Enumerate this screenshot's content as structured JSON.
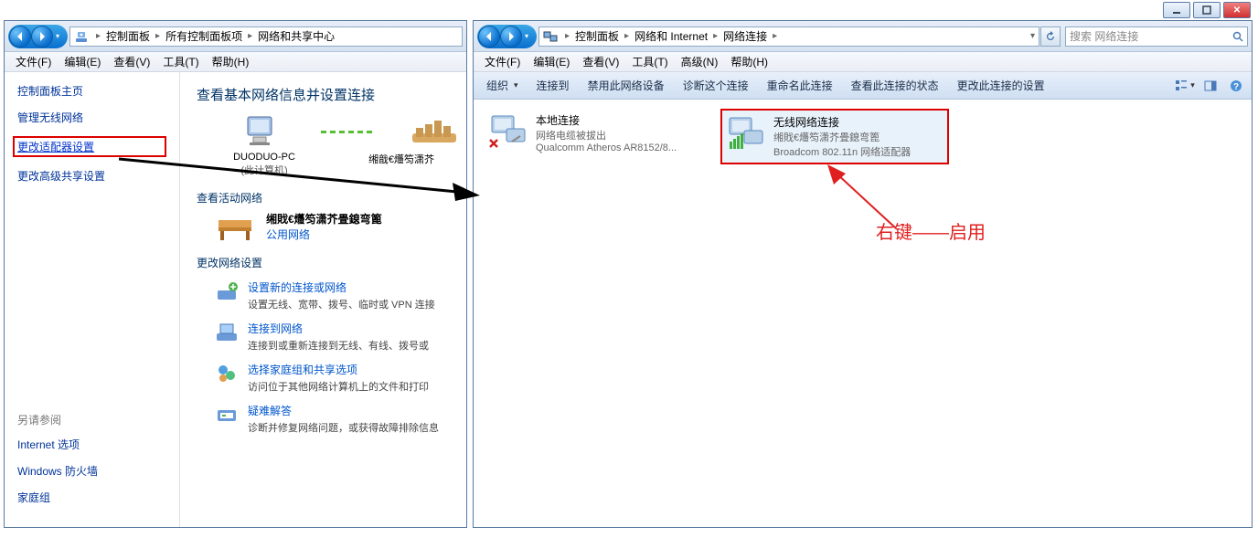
{
  "left_window": {
    "breadcrumb": [
      "控制面板",
      "所有控制面板项",
      "网络和共享中心"
    ],
    "menu": [
      "文件(F)",
      "编辑(E)",
      "查看(V)",
      "工具(T)",
      "帮助(H)"
    ],
    "sidebar": {
      "title": "控制面板主页",
      "links": [
        "管理无线网络",
        "更改适配器设置",
        "更改高级共享设置"
      ],
      "seealso_title": "另请参阅",
      "seealso": [
        "Internet 选项",
        "Windows 防火墙",
        "家庭组"
      ]
    },
    "content": {
      "heading": "查看基本网络信息并设置连接",
      "pc_name": "DUODUO-PC",
      "pc_sub": "(此计算机)",
      "network_name": "缃戠€爡笉潇芥",
      "section_activity": "查看活动网络",
      "active_net_name": "缃戝€爡笉潇芥畳鎴弯篦",
      "active_net_type": "公用网络",
      "section_settings": "更改网络设置",
      "settings": [
        {
          "t": "设置新的连接或网络",
          "d": "设置无线、宽带、拨号、临时或 VPN 连接"
        },
        {
          "t": "连接到网络",
          "d": "连接到或重新连接到无线、有线、拨号或"
        },
        {
          "t": "选择家庭组和共享选项",
          "d": "访问位于其他网络计算机上的文件和打印"
        },
        {
          "t": "疑难解答",
          "d": "诊断并修复网络问题，或获得故障排除信息"
        }
      ]
    }
  },
  "right_window": {
    "breadcrumb": [
      "控制面板",
      "网络和 Internet",
      "网络连接"
    ],
    "search_placeholder": "搜索 网络连接",
    "menu": [
      "文件(F)",
      "编辑(E)",
      "查看(V)",
      "工具(T)",
      "高级(N)",
      "帮助(H)"
    ],
    "toolbar": [
      "组织",
      "连接到",
      "禁用此网络设备",
      "诊断这个连接",
      "重命名此连接",
      "查看此连接的状态",
      "更改此连接的设置"
    ],
    "connections": [
      {
        "name": "本地连接",
        "status": "网络电缆被拔出",
        "device": "Qualcomm Atheros AR8152/8..."
      },
      {
        "name": "无线网络连接",
        "status": "缃戝€爡笉潇芥畳鎴弯篦",
        "device": "Broadcom 802.11n 网络适配器"
      }
    ]
  },
  "annotation": "右键——启用"
}
